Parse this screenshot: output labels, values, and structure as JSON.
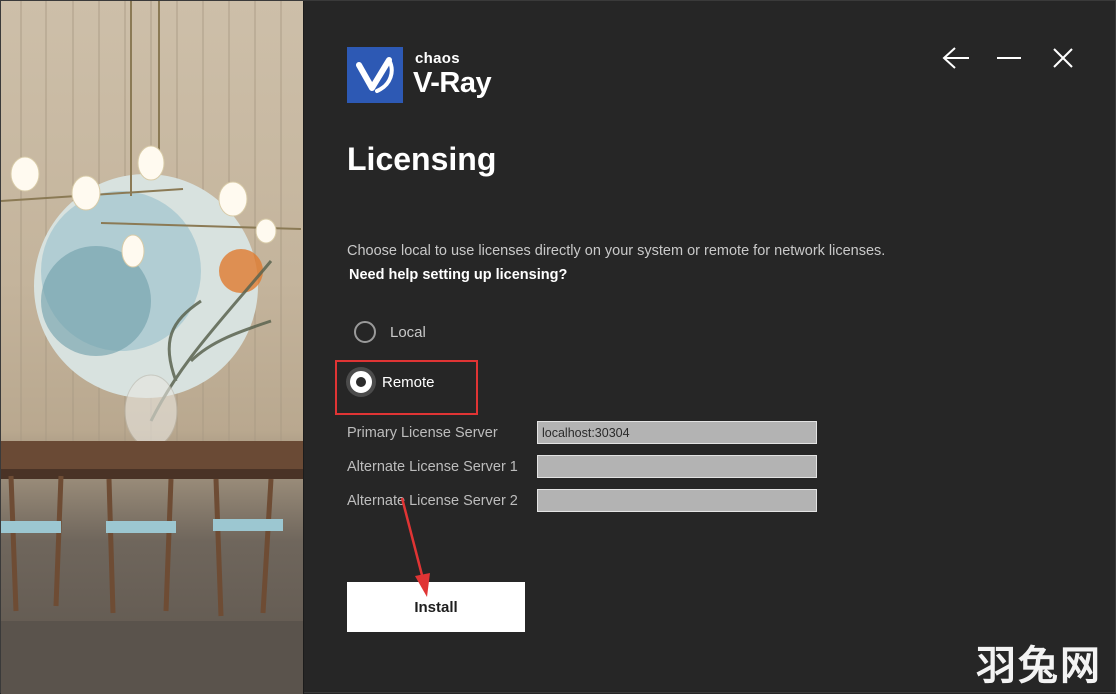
{
  "brand": {
    "company": "chaos",
    "product": "V-Ray",
    "accent_color": "#2d59b4"
  },
  "window_controls": {
    "back_icon": "arrow-left-icon",
    "minimize_icon": "minimize-icon",
    "close_icon": "close-icon"
  },
  "page": {
    "title": "Licensing",
    "description": "Choose local to use licenses directly on your system or remote for network licenses.",
    "help_link": "Need help setting up licensing?"
  },
  "license_mode": {
    "options": [
      {
        "label": "Local",
        "selected": false
      },
      {
        "label": "Remote",
        "selected": true
      }
    ]
  },
  "servers": {
    "primary_label": "Primary License Server",
    "primary_value": "localhost:30304",
    "alternate1_label": "Alternate License Server 1",
    "alternate1_value": "",
    "alternate2_label": "Alternate License Server 2",
    "alternate2_value": ""
  },
  "actions": {
    "install_label": "Install"
  },
  "annotations": {
    "highlight_color": "#e03434"
  },
  "watermark": "羽兔网"
}
